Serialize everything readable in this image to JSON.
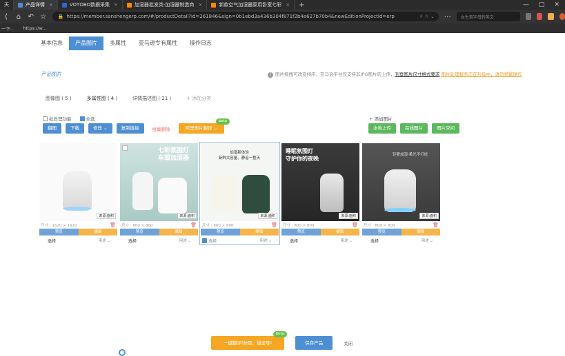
{
  "browser": {
    "tabs": [
      {
        "label": "天",
        "active": false,
        "favicon_color": "#888888"
      },
      {
        "label": "产品详情",
        "active": true,
        "favicon_color": "#4e8fd3"
      },
      {
        "label": "VOTOBO数据采集",
        "active": false,
        "favicon_color": "#3366cc"
      },
      {
        "label": "加湿器批发类-加湿器制造商",
        "active": false,
        "favicon_color": "#ff8800"
      },
      {
        "label": "新款空气加湿器家用卧室七彩",
        "active": false,
        "favicon_color": "#ff8800"
      }
    ],
    "new_tab": "+",
    "url": "https://member.sanshengerp.com/#/productDetail?id=261846&sign=0b1ebd3a436b304f871f2b4e627b70b4&newEditionProjectId=erp",
    "search_placeholder": "女生首字母转英文",
    "bookmarks": [
      "一下...",
      "https://w..."
    ]
  },
  "subtabs": [
    {
      "label": "基本信息",
      "active": false
    },
    {
      "label": "产品图片",
      "active": true
    },
    {
      "label": "多属性",
      "active": false
    },
    {
      "label": "亚马逊专有属性",
      "active": false
    },
    {
      "label": "操作日志",
      "active": false
    }
  ],
  "section_title": "产品图片",
  "tip": {
    "text": "图片拖拽可改变排序，亚马逊平台仅支持非JPG图片的上传，",
    "link": "刊登图片尺寸格式要求",
    "warn": "图片处理服务正在升级中，请勿频繁操作"
  },
  "category_tabs": [
    {
      "label": "图像图 ( 5 )"
    },
    {
      "label": "多属性图 ( 4 )"
    },
    {
      "label": "详情描述图 ( 21 )"
    }
  ],
  "add_category": "+ 添加分类",
  "options": {
    "batch": "批处理功能",
    "select_all": "全选",
    "add_image": "+ 添加图片"
  },
  "toolbar": {
    "translate": "翻图",
    "download": "下载",
    "edit": "修改 ⌄",
    "copy_link": "复制链接",
    "batch_delete": "批量删除",
    "ai_process": "阿里图片翻译 ⌄",
    "beta": "beta",
    "local_upload": "本地上传",
    "online_image": "在线图片",
    "image_space": "图片空间"
  },
  "cards": [
    {
      "size": "尺寸 : 1620 × 1620",
      "source": "来源:面积",
      "preview": "预览",
      "edit": "编辑",
      "select": "选择",
      "usage": "用途 ⌄",
      "selected": false,
      "checked": false
    },
    {
      "size": "尺寸 : 800 × 800",
      "source": "来源:面积",
      "preview": "预览",
      "edit": "编辑",
      "select": "选择",
      "usage": "用途 ⌄",
      "selected": false,
      "checked": false,
      "overlay": "七彩氛围灯\n车载加湿器"
    },
    {
      "size": "尺寸 : 800 × 800",
      "source": "来源:面积",
      "preview": "预览",
      "edit": "编辑",
      "select": "选择",
      "usage": "用途 ⌄",
      "selected": true,
      "checked": true,
      "overlay": "加湿新体验\n新鲜大容量、静音一整天"
    },
    {
      "size": "尺寸 : 800 × 800",
      "source": "来源:面积",
      "preview": "预览",
      "edit": "编辑",
      "select": "选择",
      "usage": "用途 ⌄",
      "selected": false,
      "checked": false,
      "overlay": "睡眠氛围灯\n守护你的夜晚"
    },
    {
      "size": "尺寸 : 800 × 800",
      "source": "来源:面积",
      "preview": "预览",
      "edit": "编辑",
      "select": "选择",
      "usage": "用途 ⌄",
      "selected": false,
      "checked": false,
      "overlay": "轻奢加湿·柔光不打扰"
    }
  ],
  "bottom": {
    "one_click": "一键翻译(标题、描述等)",
    "beta": "beta",
    "save": "保存产品",
    "close": "关闭"
  },
  "colors": {
    "primary": "#4e8fd3",
    "green": "#5cb85c",
    "orange": "#f5a623",
    "danger": "#e05a5a"
  }
}
